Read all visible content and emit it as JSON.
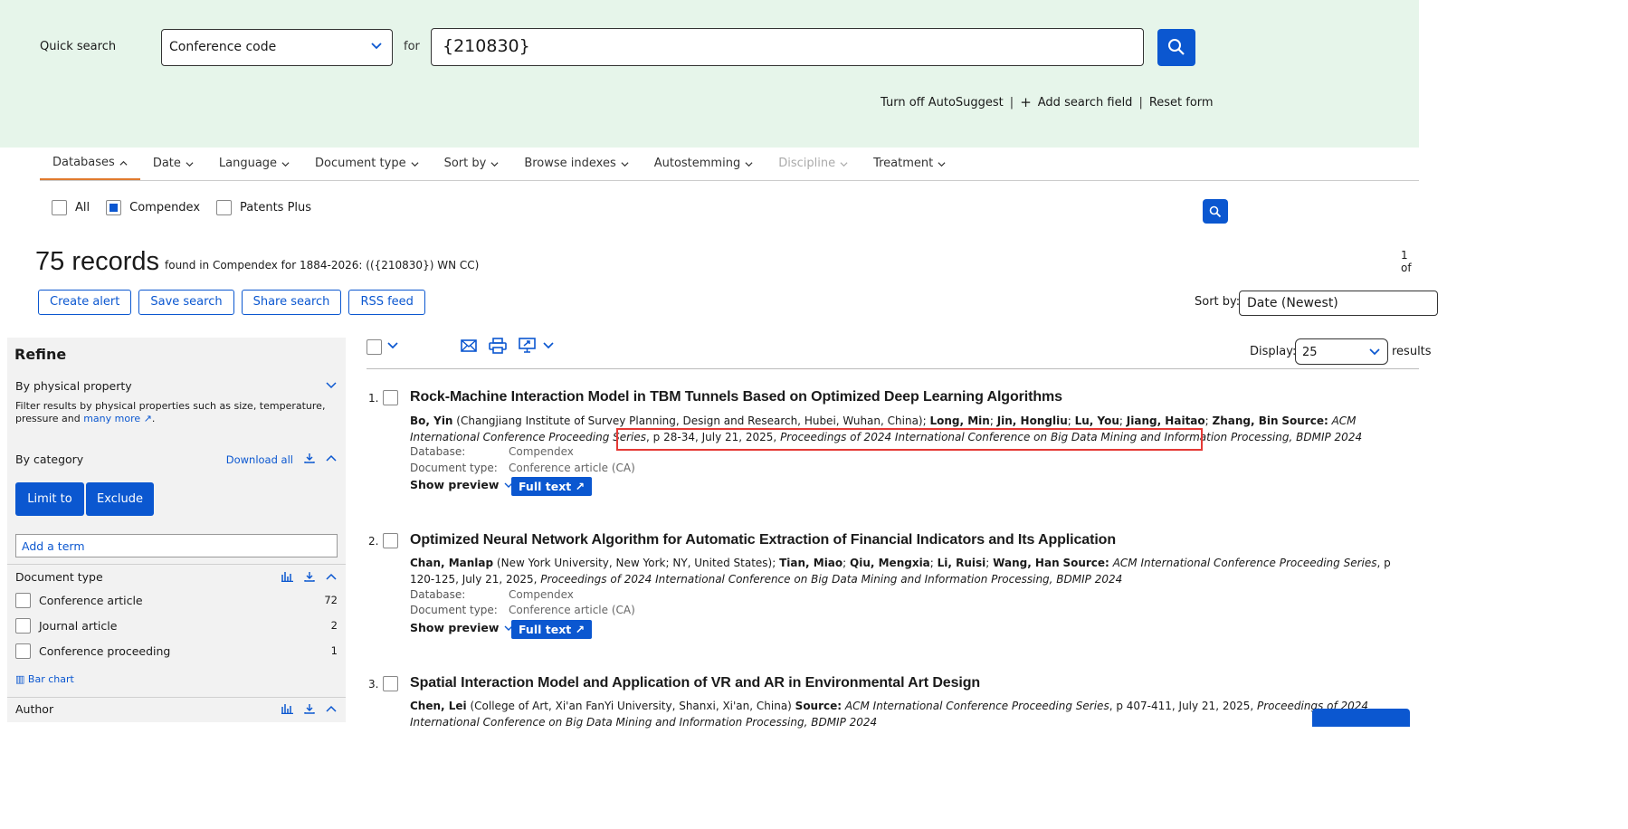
{
  "quick_search": {
    "label": "Quick search",
    "field": "Conference code",
    "for_label": "for",
    "query": "{210830}",
    "links": [
      "Turn off AutoSuggest",
      "Add search field",
      "Reset form"
    ]
  },
  "tabs": [
    "Databases",
    "Date",
    "Language",
    "Document type",
    "Sort by",
    "Browse indexes",
    "Autostemming",
    "Discipline",
    "Treatment"
  ],
  "databases": {
    "all": "All",
    "compendex": "Compendex",
    "patents": "Patents Plus"
  },
  "records": {
    "count": "75 records",
    "found_text": "found in Compendex for 1884-2026: (({210830}) WN CC)",
    "pager": "1 of"
  },
  "actions": [
    "Create alert",
    "Save search",
    "Share search",
    "RSS feed"
  ],
  "sort": {
    "label": "Sort by:",
    "value": "Date (Newest)"
  },
  "display": {
    "label": "Display:",
    "value": "25",
    "suffix": "results"
  },
  "refine": {
    "title": "Refine",
    "physical": {
      "title": "By physical property",
      "desc": "Filter results by physical properties such as size, temperature, pressure and",
      "more": "many more",
      "dot": "."
    },
    "category": {
      "title": "By category",
      "download_all": "Download all"
    },
    "limit": "Limit to",
    "exclude": "Exclude",
    "term_placeholder": "Add a term",
    "doc_type": {
      "title": "Document type",
      "items": [
        {
          "label": "Conference article",
          "count": "72"
        },
        {
          "label": "Journal article",
          "count": "2"
        },
        {
          "label": "Conference proceeding",
          "count": "1"
        }
      ],
      "bar_chart": "Bar chart"
    },
    "author": {
      "title": "Author"
    }
  },
  "results": [
    {
      "num": "1.",
      "title": "Rock-Machine Interaction Model in TBM Tunnels Based on Optimized Deep Learning Algorithms",
      "authors_html": "<b>Bo, Yin</b> (Changjiang Institute of Survey Planning, Design and Research, Hubei, Wuhan, China); <b>Long, Min</b>; <b>Jin, Hongliu</b>; <b>Lu, You</b>; <b>Jiang, Haitao</b>; <b>Zhang, Bin</b> <b>Source:</b> <i>ACM International Conference Proceeding Series</i>, p 28-34, July 21, 2025, <i>Proceedings of 2024 International Conference on Big Data Mining and Information Processing, BDMIP 2024</i>",
      "database_label": "Database:",
      "database": "Compendex",
      "doctype_label": "Document type:",
      "doctype": "Conference article (CA)",
      "show_preview": "Show preview",
      "full_text": "Full text"
    },
    {
      "num": "2.",
      "title": "Optimized Neural Network Algorithm for Automatic Extraction of Financial Indicators and Its Application",
      "authors_html": "<b>Chan, Manlap</b> (New York University, New York; NY, United States); <b>Tian, Miao</b>; <b>Qiu, Mengxia</b>; <b>Li, Ruisi</b>; <b>Wang, Han</b> <b>Source:</b> <i>ACM International Conference Proceeding Series</i>, p 120-125, July 21, 2025, <i>Proceedings of 2024 International Conference on Big Data Mining and Information Processing, BDMIP 2024</i>",
      "database_label": "Database:",
      "database": "Compendex",
      "doctype_label": "Document type:",
      "doctype": "Conference article (CA)",
      "show_preview": "Show preview",
      "full_text": "Full text"
    },
    {
      "num": "3.",
      "title": "Spatial Interaction Model and Application of VR and AR in Environmental Art Design",
      "authors_html": "<b>Chen, Lei</b> (College of Art, Xi'an FanYi University, Shanxi, Xi'an, China) <b>Source:</b> <i>ACM International Conference Proceeding Series</i>, p 407-411, July 21, 2025, <i>Proceedings of 2024 International Conference on Big Data Mining and Information Processing, BDMIP 2024</i>"
    }
  ]
}
